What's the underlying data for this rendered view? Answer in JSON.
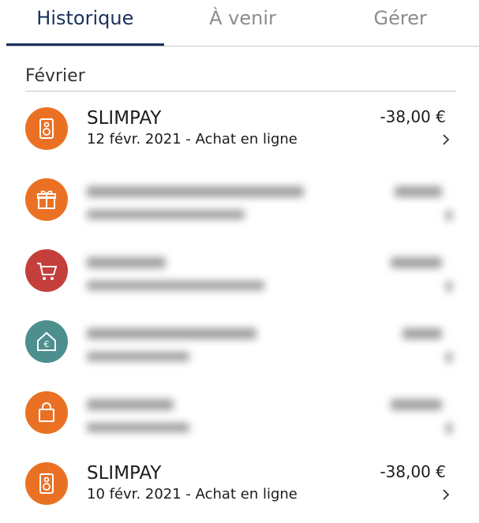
{
  "tabs": [
    {
      "label": "Historique",
      "active": true
    },
    {
      "label": "À venir",
      "active": false
    },
    {
      "label": "Gérer",
      "active": false
    }
  ],
  "month": "Février",
  "transactions": [
    {
      "merchant": "SLIMPAY",
      "detail": "12 févr. 2021 - Achat en ligne",
      "amount": "-38,00 €",
      "icon": "speaker-icon",
      "color": "#ea7124",
      "blurred": false
    },
    {
      "icon": "gift-icon",
      "color": "#ea7124",
      "blurred": true
    },
    {
      "icon": "cart-icon",
      "color": "#c43f3b",
      "blurred": true
    },
    {
      "icon": "house-euro-icon",
      "color": "#4c8f8e",
      "blurred": true
    },
    {
      "icon": "shopping-bag-icon",
      "color": "#ea7124",
      "blurred": true
    },
    {
      "merchant": "SLIMPAY",
      "detail": "10 févr. 2021 - Achat en ligne",
      "amount": "-38,00 €",
      "icon": "speaker-icon",
      "color": "#ea7124",
      "blurred": false
    }
  ],
  "colors": {
    "accent": "#19315e",
    "divider": "#c9c9c9"
  }
}
